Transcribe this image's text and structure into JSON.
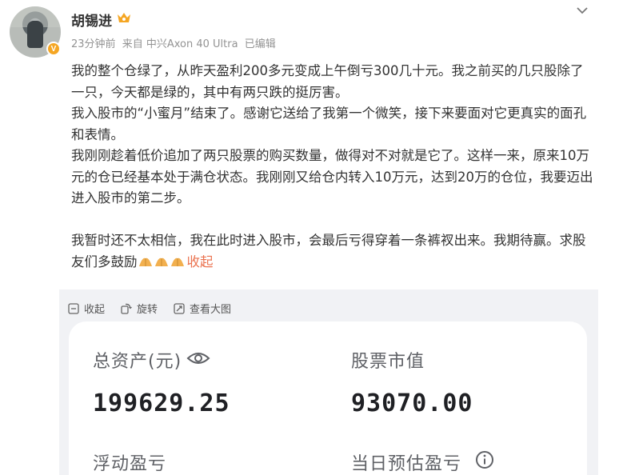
{
  "post": {
    "username": "胡锡进",
    "avatar_badge": "V",
    "meta": {
      "time": "23分钟前",
      "source": "来自 中兴Axon 40 Ultra",
      "edited": "已编辑"
    },
    "paragraphs": [
      "我的整个仓绿了，从昨天盈利200多元变成上午倒亏300几十元。我之前买的几只股除了一只，今天都是绿的，其中有两只跌的挺厉害。",
      "我入股市的“小蜜月”结束了。感谢它送给了我第一个微笑，接下来要面对它更真实的面孔和表情。",
      "我刚刚趁着低价追加了两只股票的购买数量，做得对不对就是它了。这样一来，原来10万元的仓已经基本处于满仓状态。我刚刚又给仓内转入10万元，达到20万的仓位，我要迈出进入股市的第二步。"
    ],
    "last_paragraph": "我暂时还不太相信，我在此时进入股市，会最后亏得穿着一条裤衩出来。我期待赢。求股友们多鼓励",
    "collapse_label": "收起",
    "icons": {
      "emoji": "praying-hands-emoji",
      "crown": "crown-icon",
      "more": "chevron-down-icon"
    },
    "colors": {
      "link": "#eb7350",
      "meta": "#939393",
      "badge": "#f5a623"
    }
  },
  "toolbar": {
    "collapse": "收起",
    "rotate": "旋转",
    "view_large": "查看大图"
  },
  "account_card": {
    "total_assets_label": "总资产(元)",
    "total_assets_value": "199629.25",
    "market_value_label": "股票市值",
    "market_value_value": "93070.00",
    "floating_pl_label": "浮动盈亏",
    "daily_pl_label": "当日预估盈亏"
  }
}
